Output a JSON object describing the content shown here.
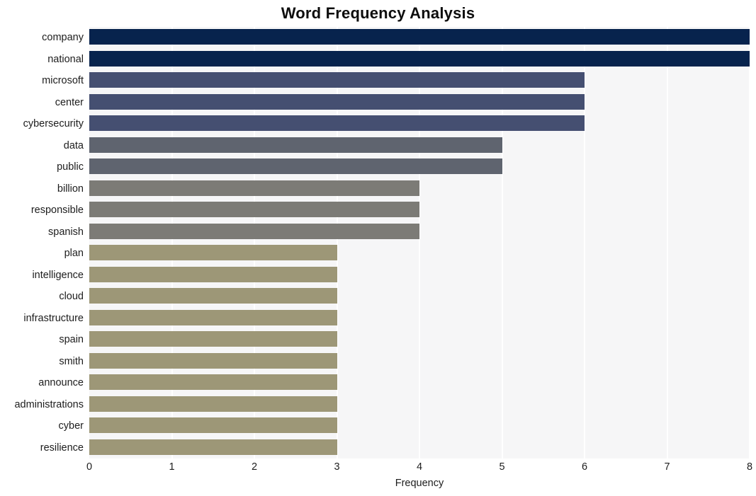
{
  "chart_data": {
    "type": "bar",
    "orientation": "horizontal",
    "title": "Word Frequency Analysis",
    "xlabel": "Frequency",
    "ylabel": "",
    "xlim": [
      0,
      8
    ],
    "xticks": [
      0,
      1,
      2,
      3,
      4,
      5,
      6,
      7,
      8
    ],
    "grid": true,
    "grid_axis": "x",
    "legend": "none",
    "categories": [
      "company",
      "national",
      "microsoft",
      "center",
      "cybersecurity",
      "data",
      "public",
      "billion",
      "responsible",
      "spanish",
      "plan",
      "intelligence",
      "cloud",
      "infrastructure",
      "spain",
      "smith",
      "announce",
      "administrations",
      "cyber",
      "resilience"
    ],
    "values": [
      8,
      8,
      6,
      6,
      6,
      5,
      5,
      4,
      4,
      4,
      3,
      3,
      3,
      3,
      3,
      3,
      3,
      3,
      3,
      3
    ],
    "bar_colors": [
      "#07234d",
      "#07234d",
      "#454f71",
      "#454f71",
      "#454f71",
      "#5f646f",
      "#5f646f",
      "#7c7b76",
      "#7c7b76",
      "#7c7b76",
      "#9d9777",
      "#9d9777",
      "#9d9777",
      "#9d9777",
      "#9d9777",
      "#9d9777",
      "#9d9777",
      "#9d9777",
      "#9d9777",
      "#9d9777"
    ]
  },
  "style": {
    "plot_background": "#f6f6f7",
    "page_background": "#ffffff",
    "gridline_color": "#ffffff",
    "title_color": "#0d0d0d",
    "tick_color": "#1d1d1d"
  }
}
